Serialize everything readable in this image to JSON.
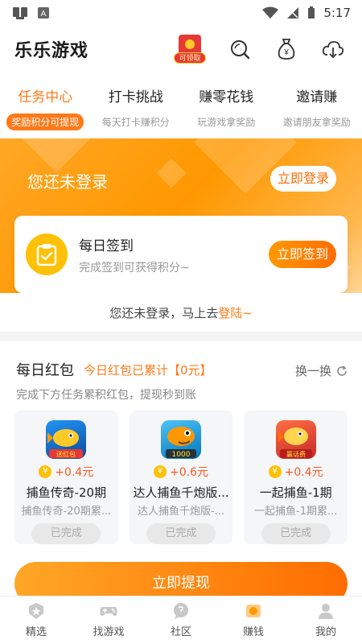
{
  "status_bar": {
    "time": "5:17"
  },
  "header": {
    "title": "乐乐游戏",
    "redpack_tag": "可领取"
  },
  "tabs": [
    {
      "label": "任务中心",
      "sub": "奖励积分可提现"
    },
    {
      "label": "打卡挑战",
      "sub": "每天打卡赚积分"
    },
    {
      "label": "赚零花钱",
      "sub": "玩游戏拿奖励"
    },
    {
      "label": "邀请赚",
      "sub": "邀请朋友拿奖励"
    }
  ],
  "hero": {
    "title": "您还未登录",
    "login_btn": "立即登录"
  },
  "checkin": {
    "title": "每日签到",
    "subtitle": "完成签到可获得积分~",
    "button": "立即签到"
  },
  "hint": {
    "text": "您还未登录，马上去",
    "link": "登陆~"
  },
  "redpacket": {
    "title": "每日红包",
    "badge": "今日红包已累计【0元】",
    "swap": "换一换",
    "desc": "完成下方任务累积红包，提现秒到账",
    "games": [
      {
        "reward": "+0.4元",
        "name": "捕鱼传奇-20期",
        "sub": "捕鱼传奇-20期累...",
        "status": "已完成",
        "icon_text": "送红包"
      },
      {
        "reward": "+0.6元",
        "name": "达人捕鱼千炮版...",
        "sub": "达人捕鱼千炮版-...",
        "status": "已完成",
        "icon_text": "1000"
      },
      {
        "reward": "+0.4元",
        "name": "一起捕鱼-1期",
        "sub": "一起捕鱼-1期累...",
        "status": "已完成",
        "icon_text": "赢话费"
      }
    ],
    "coin_symbol": "¥"
  },
  "withdraw_btn": "立即提现",
  "bottom_nav": [
    {
      "label": "精选"
    },
    {
      "label": "找游戏"
    },
    {
      "label": "社区"
    },
    {
      "label": "赚钱"
    },
    {
      "label": "我的"
    }
  ],
  "colors": {
    "accent": "#ff7a1a",
    "hero_start": "#ffa726",
    "hero_end": "#ffe0b2"
  }
}
